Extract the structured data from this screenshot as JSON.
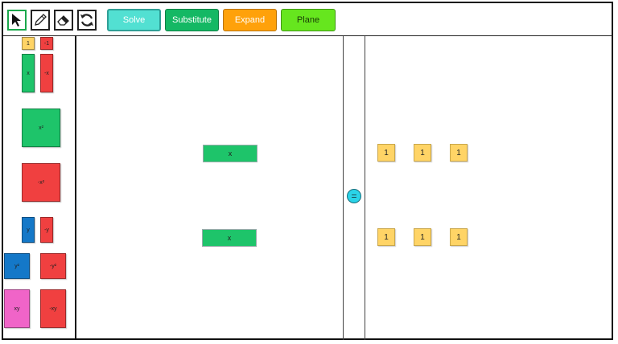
{
  "toolbar": {
    "tools": [
      {
        "name": "select-tool",
        "icon": "arrow-pointer-icon"
      },
      {
        "name": "pencil-tool",
        "icon": "pencil-icon"
      },
      {
        "name": "eraser-tool",
        "icon": "eraser-icon"
      },
      {
        "name": "reset-tool",
        "icon": "refresh-icon"
      }
    ],
    "buttons": {
      "solve": "Solve",
      "substitute": "Substitute",
      "expand": "Expand",
      "plane": "Plane"
    }
  },
  "palette": {
    "one": "1",
    "neg_one": "-1",
    "x": "x",
    "neg_x": "-x",
    "x2": "x²",
    "neg_x2": "-x²",
    "y": "y",
    "neg_y": "-y",
    "y2": "y²",
    "neg_y2": "-y²",
    "xy": "xy",
    "neg_xy": "-xy"
  },
  "equation": {
    "equals": "=",
    "left_rows": [
      [
        "x"
      ],
      [
        "x"
      ]
    ],
    "right_rows": [
      [
        "1",
        "1",
        "1"
      ],
      [
        "1",
        "1",
        "1"
      ]
    ]
  },
  "colors": {
    "solve": "#52e0d2",
    "substitute": "#14b864",
    "expand": "#ffa10a",
    "plane": "#66e61e",
    "one_tile": "#ffd466",
    "neg_tile": "#f04040",
    "x_tile": "#1ec46a",
    "y_tile": "#1478c8",
    "xy_tile": "#f064c8",
    "equals": "#2ad3e8"
  }
}
